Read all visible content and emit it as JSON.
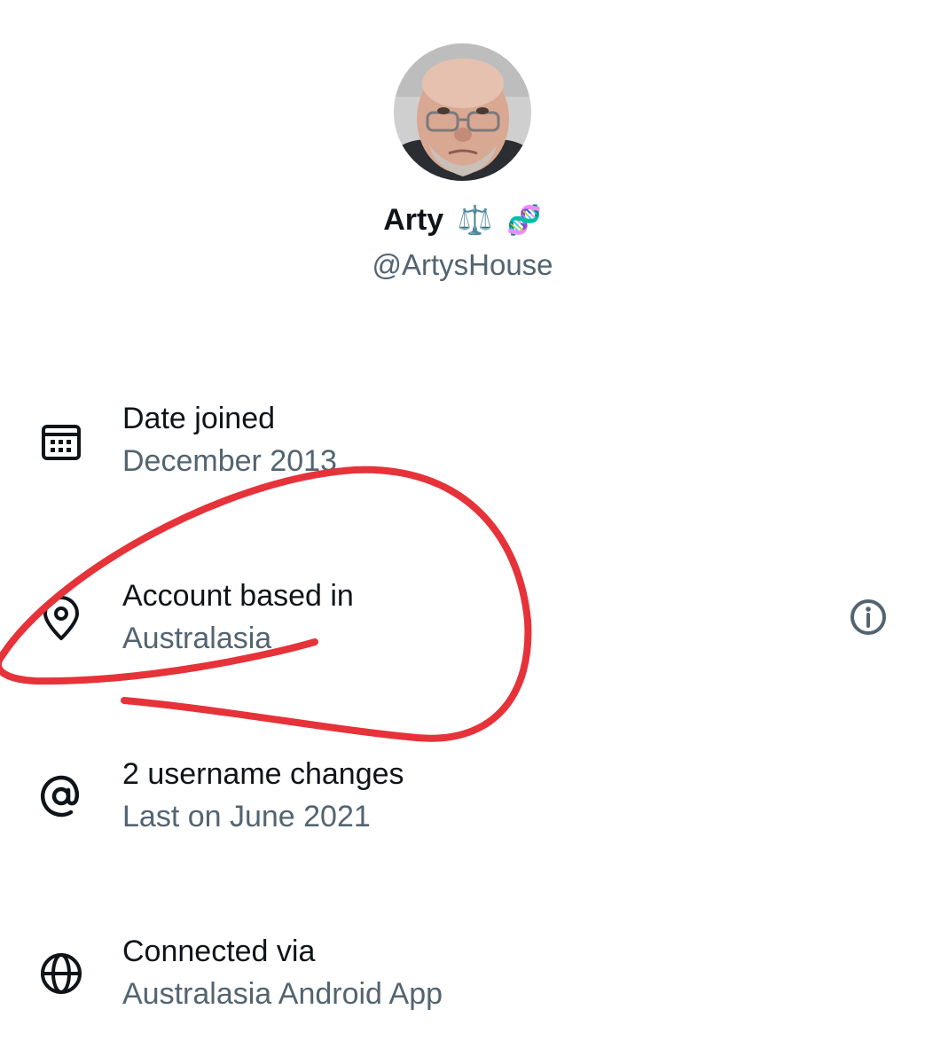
{
  "profile": {
    "display_name": "Arty",
    "emoji_1": "⚖️",
    "emoji_2": "🧬",
    "handle": "@ArtysHouse"
  },
  "rows": [
    {
      "icon": "calendar-icon",
      "title": "Date joined",
      "value": "December 2013"
    },
    {
      "icon": "location-pin-icon",
      "title": "Account based in",
      "value": "Australasia"
    },
    {
      "icon": "at-sign-icon",
      "title": "2 username changes",
      "value": "Last on June 2021"
    },
    {
      "icon": "globe-icon",
      "title": "Connected via",
      "value": "Australasia Android App"
    }
  ],
  "info_icon": "info-icon",
  "annotation_color": "#e63239"
}
